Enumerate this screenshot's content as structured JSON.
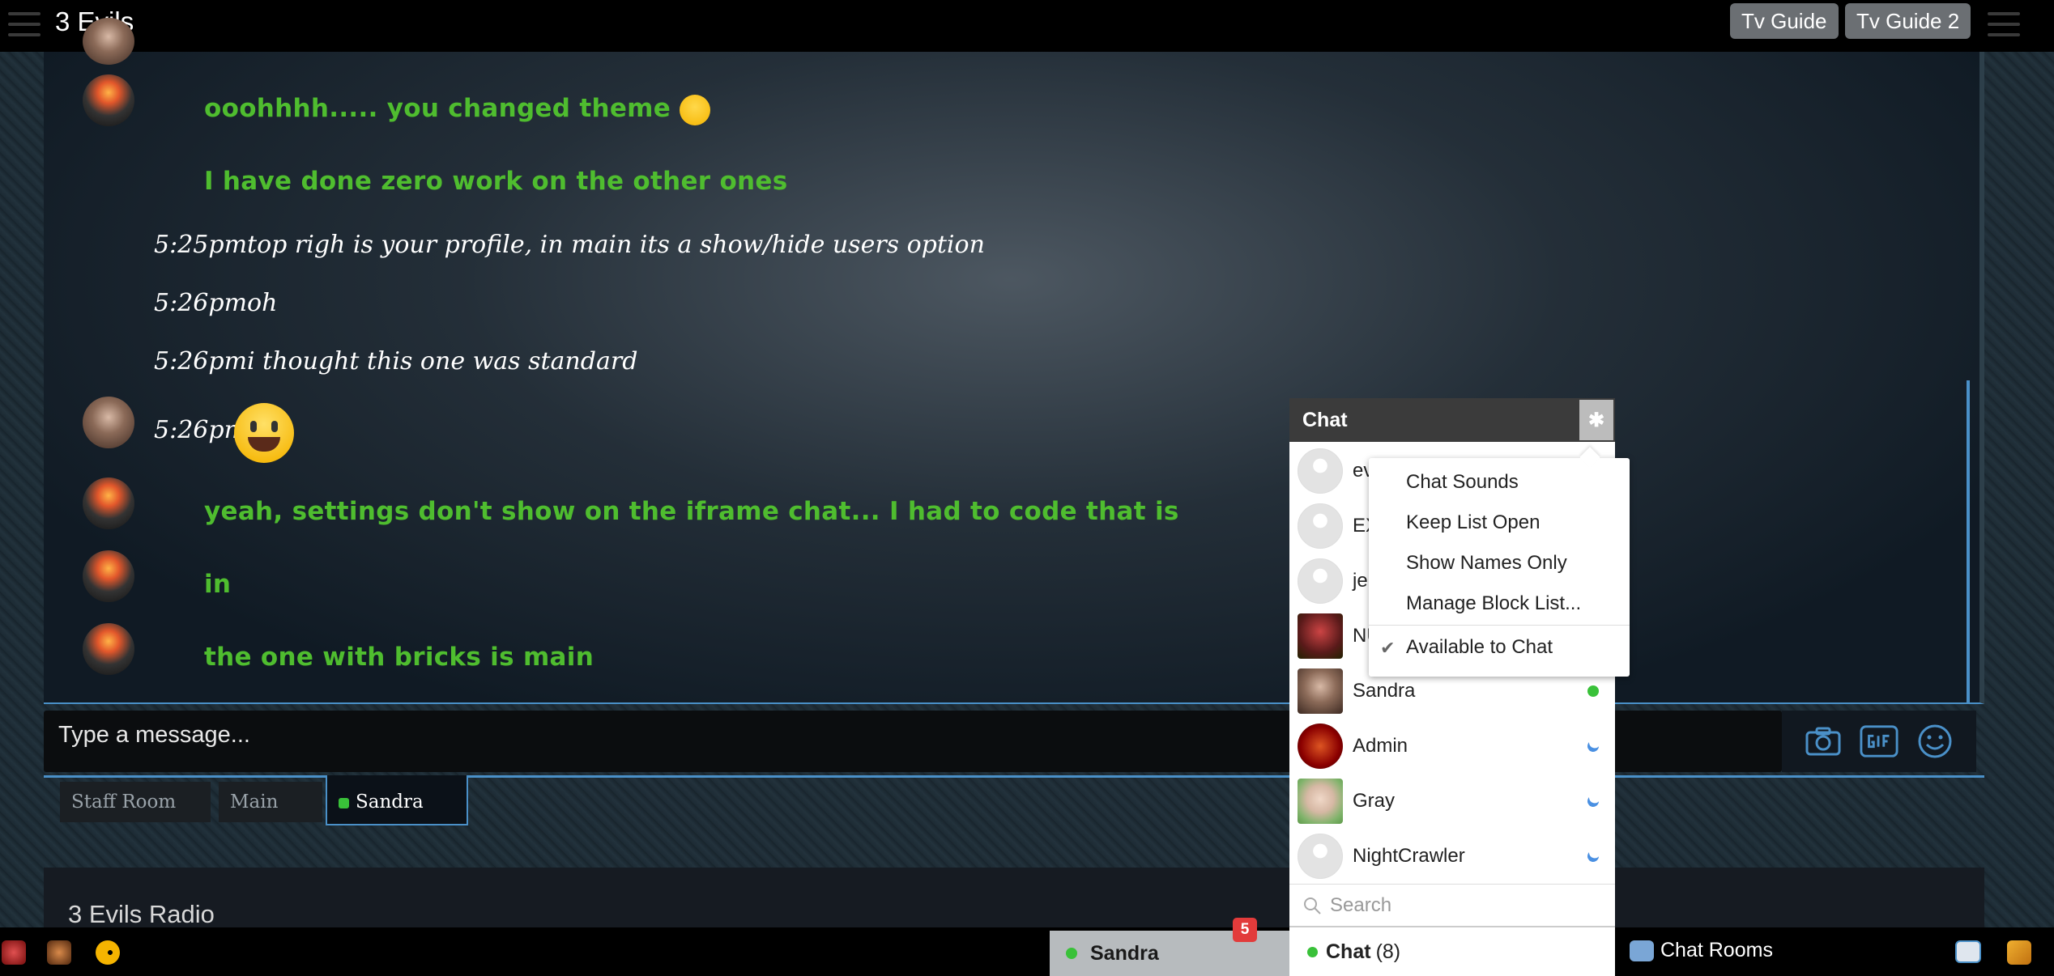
{
  "header": {
    "title": "3 Evils",
    "buttons": [
      "Tv Guide",
      "Tv Guide 2"
    ]
  },
  "messages": [
    {
      "type": "green",
      "avatar": "fire",
      "text": "ooohhhh..... you changed theme"
    },
    {
      "type": "green",
      "avatar": "",
      "text": "I have done zero work on the other ones"
    },
    {
      "type": "white",
      "avatar": "",
      "text": "5:25pmtop righ is your profile, in main its a show/hide users option"
    },
    {
      "type": "white",
      "avatar": "",
      "text": "5:26pmoh"
    },
    {
      "type": "white",
      "avatar": "",
      "text": "5:26pmi thought this one was standard"
    },
    {
      "type": "white",
      "avatar": "woman",
      "text": "5:26pm"
    },
    {
      "type": "green",
      "avatar": "fire",
      "text": "yeah, settings don't show on the iframe chat... I had to code that is"
    },
    {
      "type": "green",
      "avatar": "fire",
      "text": "in"
    },
    {
      "type": "green",
      "avatar": "fire",
      "text": "the one with bricks is main"
    }
  ],
  "composer": {
    "placeholder": "Type a message..."
  },
  "room_tabs": [
    {
      "label": "Staff Room",
      "active": false
    },
    {
      "label": "Main",
      "active": false
    },
    {
      "label": "Sandra",
      "active": true
    }
  ],
  "radio": {
    "title": "3 Evils Radio"
  },
  "chat_sidebar": {
    "title": "Chat",
    "contacts": [
      {
        "name": "ev",
        "status": ""
      },
      {
        "name": "EX",
        "status": ""
      },
      {
        "name": "je",
        "status": ""
      },
      {
        "name": "NU",
        "status": ""
      },
      {
        "name": "Sandra",
        "status": "online"
      },
      {
        "name": "Admin",
        "status": "away"
      },
      {
        "name": "Gray",
        "status": "away"
      },
      {
        "name": "NightCrawler",
        "status": "away"
      }
    ],
    "search_placeholder": "Search",
    "footer_label": "Chat",
    "footer_count": "(8)"
  },
  "settings_menu": {
    "items": [
      "Chat Sounds",
      "Keep List Open",
      "Show Names Only",
      "Manage Block List..."
    ],
    "checked_item": "Available to Chat"
  },
  "bottom_bar": {
    "chat_tab": "Sandra",
    "badge": "5",
    "chat_rooms": "Chat Rooms"
  },
  "colors": {
    "accent": "#4a90c8",
    "green_text": "#4fbd2f",
    "online": "#39c139",
    "badge": "#e23b3b"
  }
}
